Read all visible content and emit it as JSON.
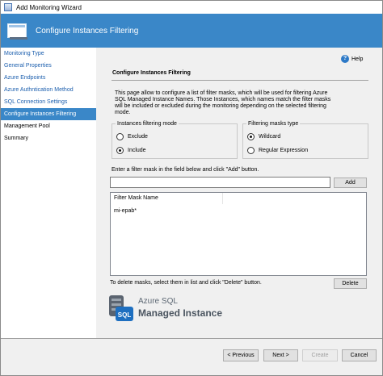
{
  "window": {
    "title": "Add Monitoring Wizard",
    "banner_title": "Configure Instances Filtering"
  },
  "nav": {
    "items": [
      {
        "label": "Monitoring Type"
      },
      {
        "label": "General Properties"
      },
      {
        "label": "Azure Endpoints"
      },
      {
        "label": "Azure Authntication Method"
      },
      {
        "label": "SQL Connection Settings"
      },
      {
        "label": "Configure Instances Filtering",
        "selected": true
      },
      {
        "label": "Management Pool"
      },
      {
        "label": "Summary"
      }
    ]
  },
  "main": {
    "help_label": "Help",
    "section_title": "Configure Instances Filtering",
    "description": "This page allow to configure a list of filter masks, which will be used for filtering Azure SQL Managed Instance Names. Those Instances, which names match the filter masks will be included or excluded during the monitoring depending on the selected filtering mode.",
    "filtering_mode": {
      "legend": "Instances filtering mode",
      "options": [
        "Exclude",
        "Include"
      ],
      "selected": "Include"
    },
    "mask_type": {
      "legend": "Filtering masks type",
      "options": [
        "Wildcard",
        "Regular Expression"
      ],
      "selected": "Wildcard"
    },
    "mask_instruction": "Enter a filter mask in the field below and click \"Add\" button.",
    "mask_input_value": "",
    "add_button": "Add",
    "list_header": "Filter Mask Name",
    "masks": [
      "mi-epab*"
    ],
    "delete_instruction": "To delete masks, select them in list and click \"Delete\" button.",
    "delete_button": "Delete",
    "logo_line1": "Azure SQL",
    "logo_line2": "Managed Instance"
  },
  "footer": {
    "previous": "< Previous",
    "next": "Next >",
    "create": "Create",
    "cancel": "Cancel"
  },
  "colors": {
    "accent": "#3a87c8",
    "link": "#1c5fae"
  }
}
